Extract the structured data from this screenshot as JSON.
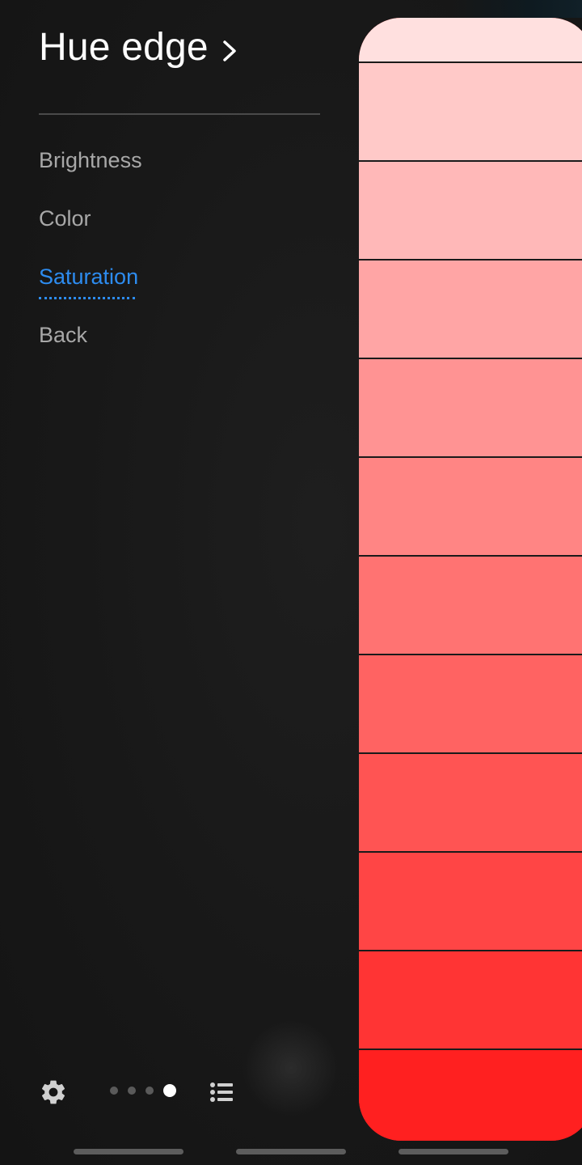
{
  "header": {
    "title": "Hue edge"
  },
  "menu": {
    "items": [
      {
        "label": "Brightness",
        "active": false
      },
      {
        "label": "Color",
        "active": false
      },
      {
        "label": "Saturation",
        "active": true
      },
      {
        "label": "Back",
        "active": false
      }
    ]
  },
  "colors": {
    "accent": "#2d8cf0",
    "background": "#1a1a1a",
    "swatches": [
      "#ffe0df",
      "#ffc9c8",
      "#ffb8b8",
      "#ffa5a5",
      "#ff9393",
      "#ff8584",
      "#ff7372",
      "#ff6362",
      "#ff5453",
      "#ff4545",
      "#ff3434",
      "#ff2020"
    ]
  },
  "footer": {
    "settings_icon": "gear-icon",
    "list_icon": "list-icon",
    "page_indicator": {
      "count": 4,
      "current": 4
    }
  }
}
